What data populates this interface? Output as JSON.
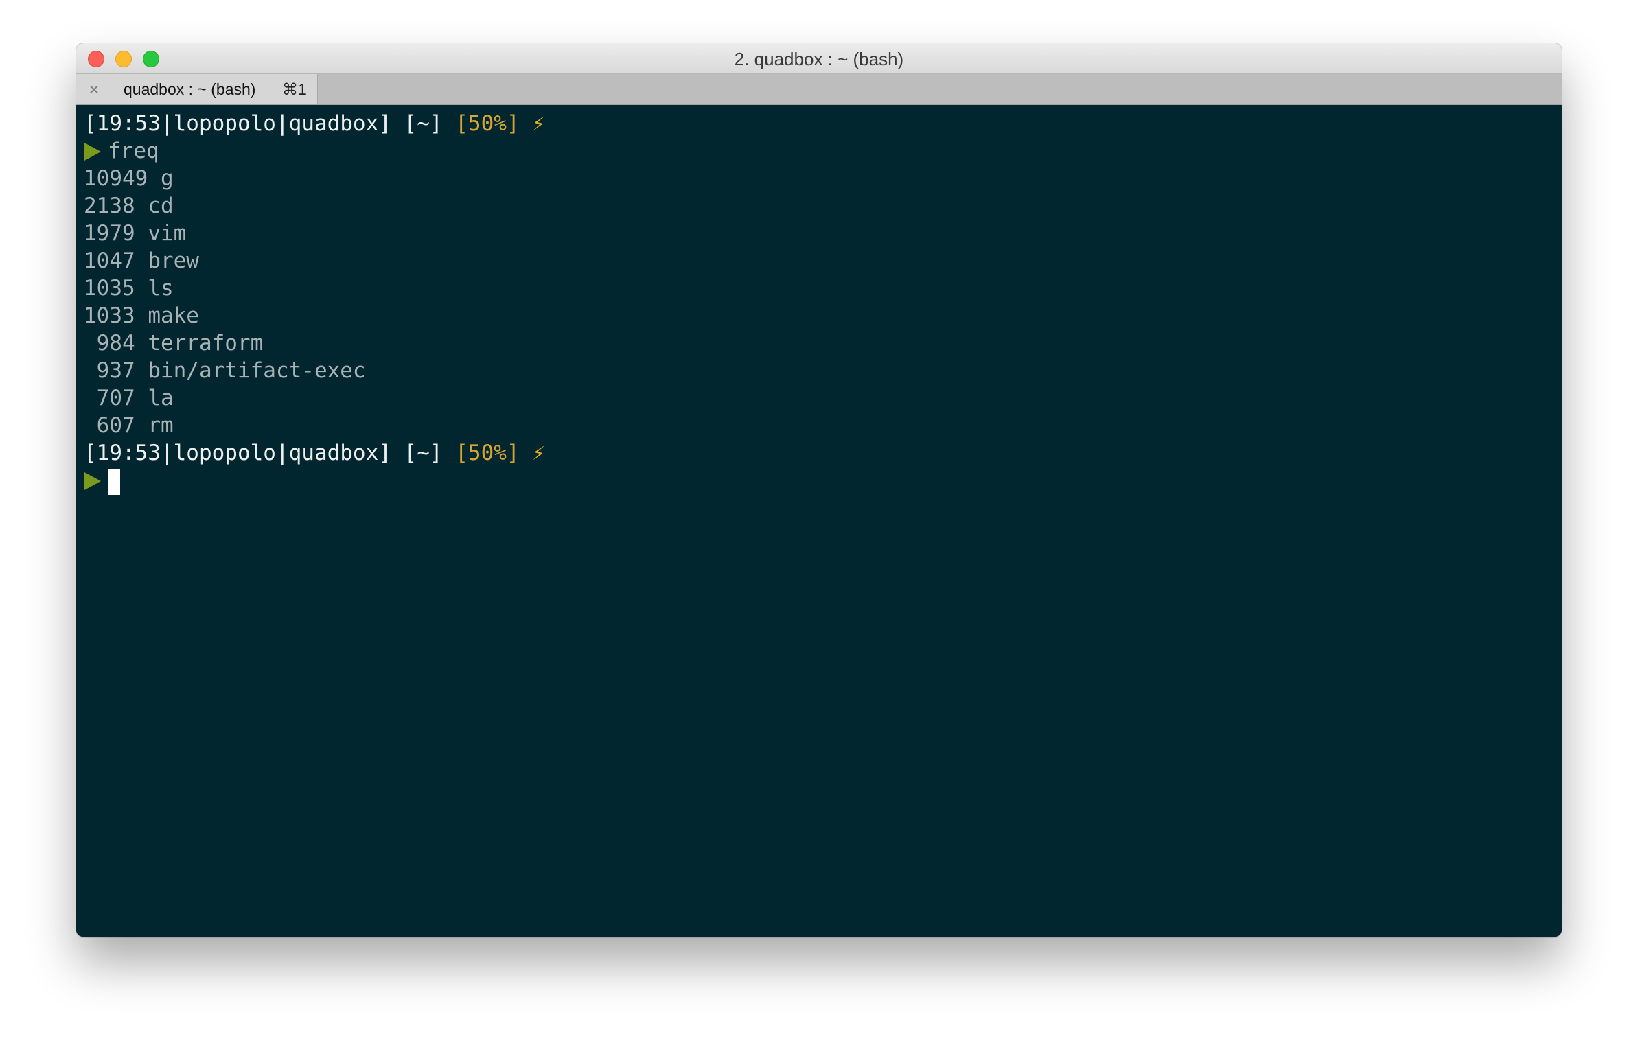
{
  "window": {
    "title": "2. quadbox : ~ (bash)"
  },
  "tab": {
    "label": "quadbox : ~ (bash)",
    "shortcut": "⌘1"
  },
  "terminal": {
    "prompt_info": "[19:53|lopopolo|quadbox] [~] ",
    "battery": "[50%]",
    "bolt": "⚡",
    "command": "freq",
    "output": [
      "10949 g",
      "2138 cd",
      "1979 vim",
      "1047 brew",
      "1035 ls",
      "1033 make",
      " 984 terraform",
      " 937 bin/artifact-exec",
      " 707 la",
      " 607 rm"
    ],
    "prompt2_info": "[19:53|lopopolo|quadbox] [~] ",
    "battery2": "[50%]",
    "bolt2": "⚡"
  },
  "colors": {
    "terminal_bg": "#02262f",
    "prompt_text": "#eef0ef",
    "battery": "#d6a430",
    "arrow": "#7c9b1c",
    "output_text": "#a9b3b6"
  }
}
